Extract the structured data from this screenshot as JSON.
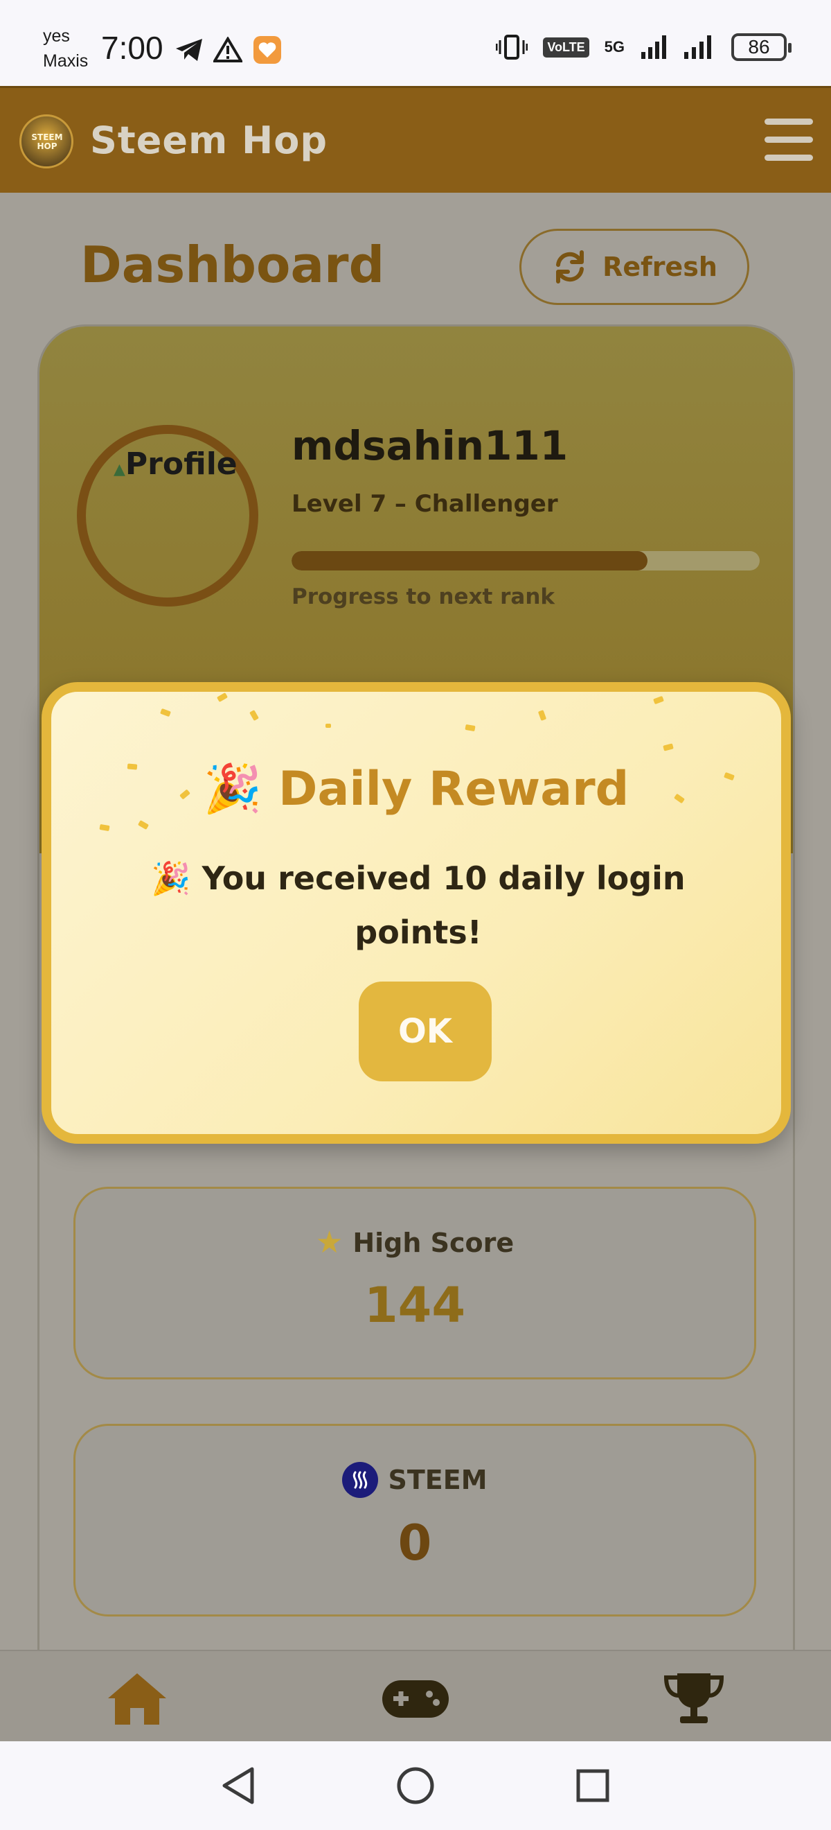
{
  "status_bar": {
    "carrier_line1": "yes",
    "carrier_line2": "Maxis",
    "time": "7:00",
    "network": "5G",
    "volte": "VoLTE",
    "battery": "86"
  },
  "app_header": {
    "title": "Steem Hop",
    "logo_text": "STEEM HOP"
  },
  "dashboard": {
    "title": "Dashboard",
    "refresh_label": "Refresh"
  },
  "profile": {
    "avatar_alt": "Profile",
    "username": "mdsahin111",
    "level": "Level 7 – Challenger",
    "progress": 0.76,
    "progress_label": "Progress to next rank"
  },
  "stats": {
    "high_score_label": "High Score",
    "high_score_value": "144",
    "steem_label": "STEEM",
    "steem_value": "0"
  },
  "modal": {
    "title_emoji": "🎉",
    "title": "Daily Reward",
    "message": "🎉 You received 10 daily login points!",
    "ok_label": "OK"
  },
  "bottom_nav": {
    "items": [
      "home-icon",
      "gamepad-icon",
      "trophy-icon"
    ]
  },
  "colors": {
    "brand": "#8a5e17",
    "accent": "#e3b73f",
    "title_gold": "#c48a23"
  }
}
